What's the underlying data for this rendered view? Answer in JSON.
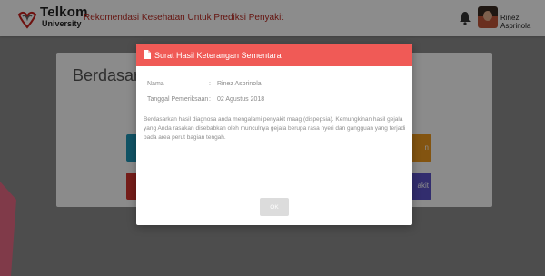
{
  "navbar": {
    "brand_top": "Telkom",
    "brand_bottom": "University",
    "title": "Rekomendasi Kesehatan Untuk Prediksi Penyakit",
    "user_name": "Rinez Asprinola"
  },
  "content": {
    "heading": "Berdasarka",
    "tile_3_text": "n",
    "tile_4_text": "akit"
  },
  "modal": {
    "title": "Surat Hasil Keterangan Sementara",
    "fields": [
      {
        "label": "Nama",
        "sep": ":",
        "value": "Rinez Asprinola"
      },
      {
        "label": "Tanggal Pemeriksaan",
        "sep": ":",
        "value": "02 Agustus 2018"
      }
    ],
    "description": "Berdasarkan hasil diagnosa anda mengalami penyakit maag (dispepsia). Kemungkinan hasil gejala yang Anda rasakan disebabkan oleh munculnya gejala berupa rasa nyeri dan gangguan yang terjadi pada area perut bagian tengah.",
    "ok_label": "OK"
  },
  "colors": {
    "modal_header": "#f05a56",
    "nav_title": "#b9271f",
    "tile_blue": "#1f97b8",
    "tile_red": "#d6362e",
    "tile_orange": "#ef9a1e",
    "tile_purple": "#5b52c8"
  },
  "icons": [
    "telkom-logo-icon",
    "bell-icon",
    "avatar",
    "document-icon"
  ]
}
